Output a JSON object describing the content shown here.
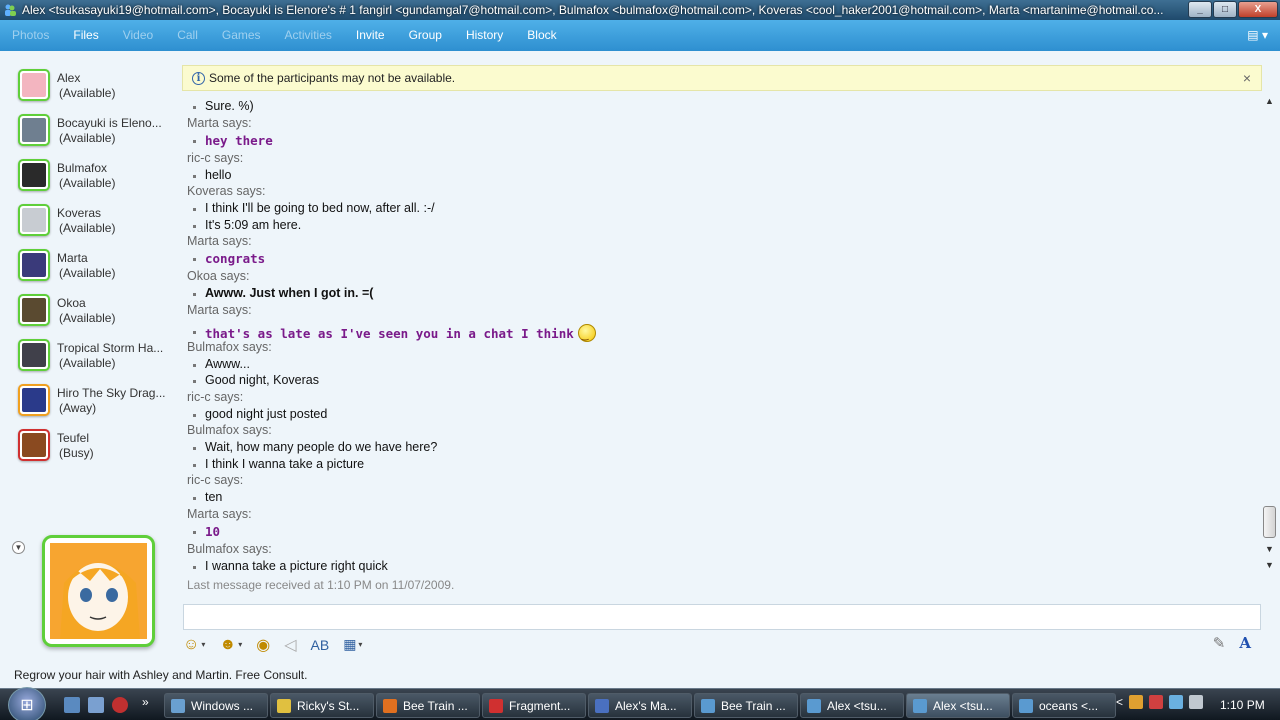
{
  "window": {
    "title": "Alex <tsukasayuki19@hotmail.com>, Bocayuki is Elenore's # 1 fangirl <gundamgal7@hotmail.com>, Bulmafox <bulmafox@hotmail.com>, Koveras <cool_haker2001@hotmail.com>, Marta <martanime@hotmail.co...",
    "minimize": "_",
    "maximize": "□",
    "close": "X"
  },
  "menu": {
    "items": [
      {
        "label": "Photos",
        "enabled": false
      },
      {
        "label": "Files",
        "enabled": true
      },
      {
        "label": "Video",
        "enabled": false
      },
      {
        "label": "Call",
        "enabled": false
      },
      {
        "label": "Games",
        "enabled": false
      },
      {
        "label": "Activities",
        "enabled": false
      },
      {
        "label": "Invite",
        "enabled": true
      },
      {
        "label": "Group",
        "enabled": true
      },
      {
        "label": "History",
        "enabled": true
      },
      {
        "label": "Block",
        "enabled": true
      }
    ],
    "options_icon": "▤ ▾"
  },
  "contacts": [
    {
      "name": "Alex",
      "status": "(Available)",
      "presence": "available",
      "color": "#f3b5c0"
    },
    {
      "name": "Bocayuki is Eleno...",
      "status": "(Available)",
      "presence": "available",
      "color": "#6f7f90"
    },
    {
      "name": "Bulmafox",
      "status": "(Available)",
      "presence": "available",
      "color": "#2a2a2a"
    },
    {
      "name": "Koveras",
      "status": "(Available)",
      "presence": "available",
      "color": "#c8ccd2"
    },
    {
      "name": "Marta",
      "status": "(Available)",
      "presence": "available",
      "color": "#3a3a7a"
    },
    {
      "name": "Okoa",
      "status": "(Available)",
      "presence": "available",
      "color": "#5a4a30"
    },
    {
      "name": "Tropical Storm Ha...",
      "status": "(Available)",
      "presence": "available",
      "color": "#40404a"
    },
    {
      "name": "Hiro The Sky Drag...",
      "status": "(Away)",
      "presence": "away",
      "color": "#2a3a8a"
    },
    {
      "name": "Teufel",
      "status": "(Busy)",
      "presence": "busy",
      "color": "#8a4a20"
    }
  ],
  "notification": {
    "text": "Some of the participants may not be available.",
    "info_icon": "i",
    "close_icon": "×"
  },
  "conversation": [
    {
      "type": "msg",
      "text": "Sure. %)",
      "style": "normal"
    },
    {
      "type": "says",
      "text": "Marta says:"
    },
    {
      "type": "msg",
      "text": "hey there",
      "style": "marta"
    },
    {
      "type": "says",
      "text": "ric-c says:"
    },
    {
      "type": "msg",
      "text": "hello",
      "style": "normal"
    },
    {
      "type": "says",
      "text": "Koveras says:"
    },
    {
      "type": "msg",
      "text": "I think I'll be going to bed now, after all. :-/",
      "style": "normal"
    },
    {
      "type": "msg",
      "text": "It's 5:09 am here.",
      "style": "normal"
    },
    {
      "type": "says",
      "text": "Marta says:"
    },
    {
      "type": "msg",
      "text": "congrats",
      "style": "marta"
    },
    {
      "type": "says",
      "text": "Okoa says:"
    },
    {
      "type": "msg",
      "text": "Awww. Just when I got in. =(",
      "style": "bold"
    },
    {
      "type": "says",
      "text": "Marta says:"
    },
    {
      "type": "msg",
      "text": "that's as late as I've seen you in a chat I think",
      "style": "marta",
      "emoticon": true
    },
    {
      "type": "says",
      "text": "Bulmafox says:"
    },
    {
      "type": "msg",
      "text": "Awww...",
      "style": "normal"
    },
    {
      "type": "msg",
      "text": "Good night, Koveras",
      "style": "normal"
    },
    {
      "type": "says",
      "text": "ric-c says:"
    },
    {
      "type": "msg",
      "text": "good night just posted",
      "style": "normal"
    },
    {
      "type": "says",
      "text": "Bulmafox says:"
    },
    {
      "type": "msg",
      "text": "Wait, how many people do we have here?",
      "style": "normal"
    },
    {
      "type": "msg",
      "text": "I think I wanna take a picture",
      "style": "normal"
    },
    {
      "type": "says",
      "text": "ric-c says:"
    },
    {
      "type": "msg",
      "text": "ten",
      "style": "normal"
    },
    {
      "type": "says",
      "text": "Marta says:"
    },
    {
      "type": "msg",
      "text": "10",
      "style": "marta"
    },
    {
      "type": "says",
      "text": "Bulmafox says:"
    },
    {
      "type": "msg",
      "text": "I wanna take a picture right quick",
      "style": "normal"
    }
  ],
  "last_message": "Last message received at 1:10 PM on 11/07/2009.",
  "input": {
    "value": "",
    "placeholder": ""
  },
  "toolbar": {
    "emoticons_icon": "☺",
    "winks_icon": "☻",
    "nudge_icon": "◉",
    "voice_clip_icon": "◁",
    "spell_icon": "AB",
    "background_icon": "▦",
    "handwriting_icon": "✎",
    "font_icon": "A",
    "caret": "▾"
  },
  "ad_text": "Regrow your hair with Ashley and Martin. Free Consult.",
  "taskbar": {
    "tasks": [
      {
        "label": "Windows ...",
        "color": "#6aa0d0",
        "active": false
      },
      {
        "label": "Ricky's St...",
        "color": "#e0c040",
        "active": false
      },
      {
        "label": "Bee Train ...",
        "color": "#e07020",
        "active": false
      },
      {
        "label": "Fragment...",
        "color": "#d03030",
        "active": false
      },
      {
        "label": "Alex's Ma...",
        "color": "#4a70c0",
        "active": false
      },
      {
        "label": "Bee Train ...",
        "color": "#5a9ad0",
        "active": false
      },
      {
        "label": "Alex <tsu...",
        "color": "#5a9ad0",
        "active": false
      },
      {
        "label": "Alex <tsu...",
        "color": "#5a9ad0",
        "active": true
      },
      {
        "label": "oceans <...",
        "color": "#5a9ad0",
        "active": false
      }
    ],
    "tray_arrow": "<",
    "clock": "1:10 PM",
    "more": "»"
  }
}
